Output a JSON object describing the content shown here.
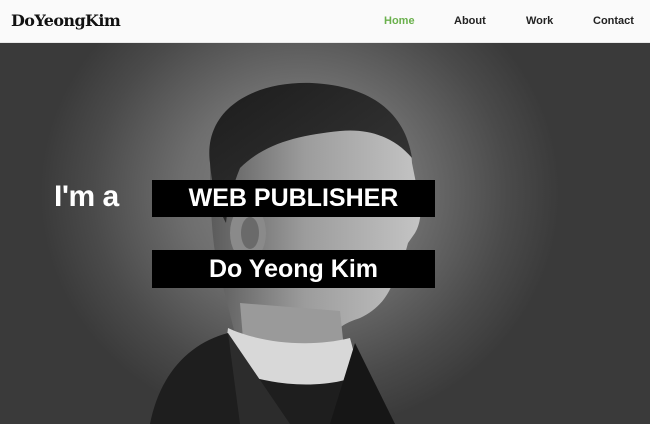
{
  "brand": {
    "logo_text": "DoYeongKim"
  },
  "nav": {
    "items": [
      {
        "label": "Home",
        "active": true
      },
      {
        "label": "About",
        "active": false
      },
      {
        "label": "Work",
        "active": false
      },
      {
        "label": "Contact",
        "active": false
      }
    ],
    "active_color": "#6ab04c"
  },
  "hero": {
    "intro": "I'm a",
    "role": "WEB PUBLISHER",
    "name": "Do Yeong Kim"
  }
}
